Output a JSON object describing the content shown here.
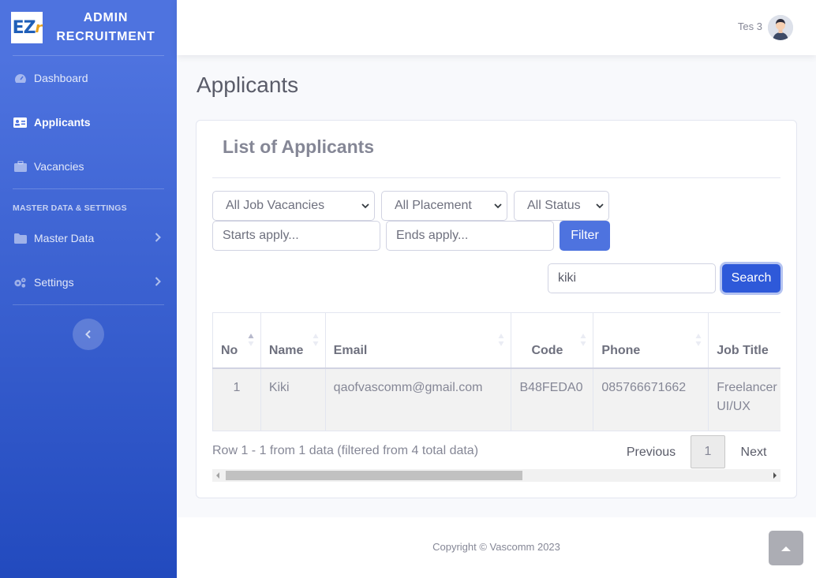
{
  "brand": {
    "logo_text": "EZr",
    "title_line1": "ADMIN",
    "title_line2": "RECRUITMENT"
  },
  "sidebar": {
    "items": [
      {
        "label": "Dashboard",
        "icon": "tachometer-icon",
        "active": false
      },
      {
        "label": "Applicants",
        "icon": "id-card-icon",
        "active": true
      },
      {
        "label": "Vacancies",
        "icon": "briefcase-icon",
        "active": false
      }
    ],
    "section_heading": "MASTER DATA & SETTINGS",
    "sub_items": [
      {
        "label": "Master Data",
        "icon": "folder-icon"
      },
      {
        "label": "Settings",
        "icon": "cogs-icon"
      }
    ]
  },
  "topbar": {
    "user_name": "Tes 3"
  },
  "page": {
    "title": "Applicants"
  },
  "card": {
    "title": "List of Applicants"
  },
  "filters": {
    "job_vacancies": "All Job Vacancies",
    "placement": "All Placement",
    "status": "All Status",
    "starts_apply_placeholder": "Starts apply...",
    "ends_apply_placeholder": "Ends apply...",
    "filter_label": "Filter"
  },
  "search": {
    "value": "kiki",
    "button_label": "Search"
  },
  "table": {
    "headers": [
      "No",
      "Name",
      "Email",
      "Code",
      "Phone",
      "Job Title"
    ],
    "rows": [
      [
        "1",
        "Kiki",
        "qaofvascomm@gmail.com",
        "B48FEDA0",
        "085766671662",
        "Freelancer UI/UX"
      ]
    ]
  },
  "pagination": {
    "info": "Row 1 - 1 from 1 data (filtered from 4 total data)",
    "previous": "Previous",
    "current": "1",
    "next": "Next"
  },
  "footer": {
    "copyright": "Copyright © Vascomm 2023"
  },
  "colors": {
    "primary": "#4e73df",
    "sidebar_end": "#224abe",
    "text_muted": "#858796"
  }
}
